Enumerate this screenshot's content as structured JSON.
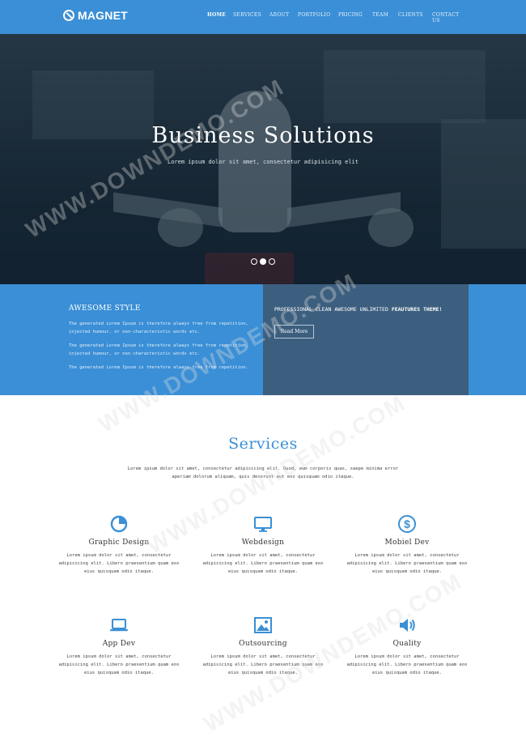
{
  "brand": {
    "name": "MAGNET"
  },
  "nav": {
    "items": [
      {
        "label": "HOME",
        "active": true
      },
      {
        "label": "SERVICES",
        "active": false
      },
      {
        "label": "ABOUT",
        "active": false
      },
      {
        "label": "PORTFOLIO",
        "active": false
      },
      {
        "label": "PRICING",
        "active": false
      },
      {
        "label": "TEAM",
        "active": false
      },
      {
        "label": "CLIENTS",
        "active": false
      },
      {
        "label": "CONTACT US",
        "active": false
      }
    ]
  },
  "hero": {
    "title": "Business Solutions",
    "subtitle": "Lorem ipsum dolor sit amet, consectetur adipisicing elit",
    "slides": 3,
    "active_slide": 2
  },
  "awesome": {
    "title": "AWESOME STYLE",
    "paragraphs": [
      "The generated Lorem Ipsum is therefore always free from repetition, injected humour, or non-characteristic words etc.",
      "The generated Lorem Ipsum is therefore always free from repetition, injected humour, or non-characteristic words etc.",
      "The generated Lorem Ipsum is therefore always free from repetition."
    ]
  },
  "promo": {
    "text": "PROFESSIONAL CLEAN AWESOME UNLIMITED",
    "bold": "FEAUTURES THEME!",
    "button": "Read More"
  },
  "services": {
    "title": "Services",
    "description": "Lorem ipsum dolor sit amet, consectetur adipisicing elit. Quod, eum corporis quas, saepe minima error aperiam dolorum aliquam, quis deserunt aut eos quisquam odio itaque.",
    "items": [
      {
        "name": "Graphic Design",
        "icon": "pie-chart-icon",
        "text": "Lorem ipsum dolor sit amet, consectetur adipisicing elit. Libero praesentium quam eos eius quisquam odio itaque."
      },
      {
        "name": "Webdesign",
        "icon": "monitor-icon",
        "text": "Lorem ipsum dolor sit amet, consectetur adipisicing elit. Libero praesentium quam eos eius quisquam odio itaque."
      },
      {
        "name": "Mobiel Dev",
        "icon": "dollar-icon",
        "text": "Lorem ipsum dolor sit amet, consectetur adipisicing elit. Libero praesentium quam eos eius quisquam odio itaque."
      },
      {
        "name": "App Dev",
        "icon": "laptop-icon",
        "text": "Lorem ipsum dolor sit amet, consectetur adipisicing elit. Libero praesentium quam eos eius quisquam odio itaque."
      },
      {
        "name": "Outsourcing",
        "icon": "image-icon",
        "text": "Lorem ipsum dolor sit amet, consectetur adipisicing elit. Libero praesentium quam eos eius quisquam odio itaque."
      },
      {
        "name": "Quality",
        "icon": "volume-icon",
        "text": "Lorem ipsum dolor sit amet, consectetur adipisicing elit. Libero praesentium quam eos eius quisquam odio itaque."
      }
    ]
  },
  "watermark": "WWW.DOWNDEMO.COM",
  "colors": {
    "primary": "#3a8fd6",
    "dark_panel": "#3d5f7f"
  }
}
